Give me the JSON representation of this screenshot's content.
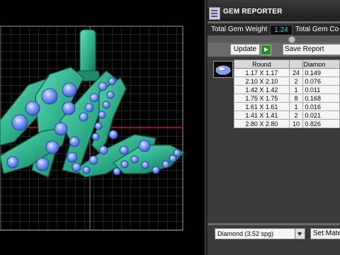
{
  "panel": {
    "title": "GEM REPORTER",
    "total_weight_label": "Total Gem Weight",
    "total_weight_value": "1.24",
    "total_count_label": "Total Gem Co",
    "update_label": "Update",
    "save_report_label": "Save Report",
    "table": {
      "headers": [
        "Round",
        "",
        "Diamon"
      ],
      "rows": [
        {
          "size": "1.17 X 1.17",
          "count": "24",
          "carat": "0.149"
        },
        {
          "size": "2.10 X 2.10",
          "count": "2",
          "carat": "0.076"
        },
        {
          "size": "1.42 X 1.42",
          "count": "1",
          "carat": "0.011"
        },
        {
          "size": "1.75 X 1.75",
          "count": "8",
          "carat": "0.168"
        },
        {
          "size": "1.61 X 1.61",
          "count": "1",
          "carat": "0.016"
        },
        {
          "size": "1.41 X 1.41",
          "count": "2",
          "carat": "0.021"
        },
        {
          "size": "2.80 X 2.80",
          "count": "10",
          "carat": "0.826"
        }
      ]
    },
    "material_select": "Diamond    (3.52 spg)",
    "set_material_label": "Set Mate"
  },
  "colors": {
    "gem_metal": "#2fae8a",
    "gem_stone": "#6f8ef0",
    "weight_value": "#33dddd",
    "grid": "#6a6a6a",
    "baseline": "#cc1111"
  }
}
